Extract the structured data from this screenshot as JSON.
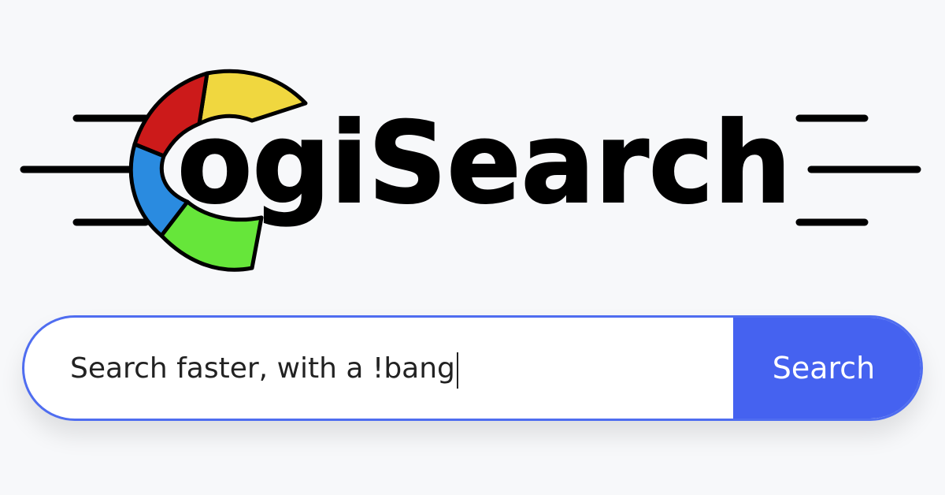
{
  "logo": {
    "word": "ogiSearch",
    "colors": {
      "red": "#cc1a1a",
      "yellow": "#f0d73f",
      "blue": "#2a8be0",
      "green": "#66e63a",
      "ink": "#000000"
    }
  },
  "search": {
    "placeholder": "Search faster, with a !bang",
    "button_label": "Search",
    "accent": "#4562f0",
    "border": "#4f6df0"
  }
}
